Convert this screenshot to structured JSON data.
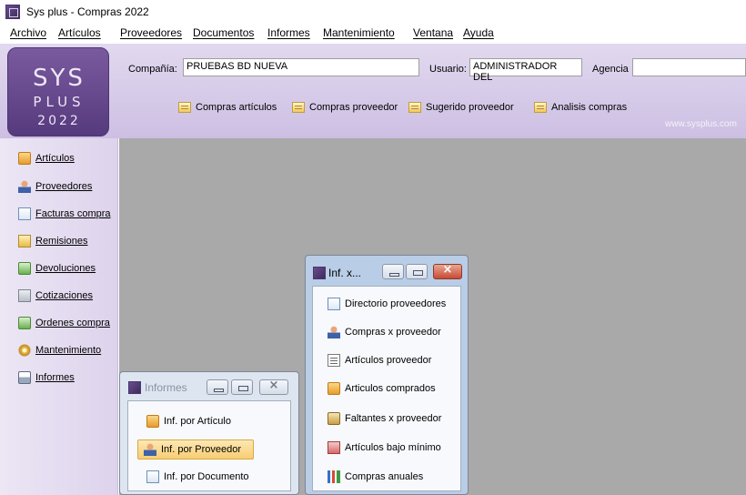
{
  "window": {
    "title": "Sys plus - Compras 2022"
  },
  "menu": [
    {
      "label": "Archivo"
    },
    {
      "label": "Artículos"
    },
    {
      "label": "Proveedores"
    },
    {
      "label": "Documentos"
    },
    {
      "label": "Informes"
    },
    {
      "label": "Mantenimiento"
    },
    {
      "label": "Ventana"
    },
    {
      "label": "Ayuda"
    }
  ],
  "logo": {
    "line1": "SYS",
    "line2": "PLUS",
    "line3": "2022"
  },
  "header": {
    "company_label": "Compañía:",
    "company_value": "PRUEBAS BD NUEVA",
    "user_label": "Usuario:",
    "user_value": "ADMINISTRADOR DEL",
    "agency_label": "Agencia",
    "agency_value": "",
    "website": "www.sysplus.com"
  },
  "toolbar": [
    {
      "label": "Compras artículos",
      "icon": "list-icon"
    },
    {
      "label": "Compras proveedor",
      "icon": "list-icon"
    },
    {
      "label": "Sugerido proveedor",
      "icon": "list-icon"
    },
    {
      "label": "Analisis compras",
      "icon": "list-icon"
    }
  ],
  "sidebar": [
    {
      "label": "Artículos",
      "icon": "box-icon"
    },
    {
      "label": "Proveedores",
      "icon": "person-icon"
    },
    {
      "label": "Facturas compra",
      "icon": "invoice-icon"
    },
    {
      "label": "Remisiones",
      "icon": "folder-icon"
    },
    {
      "label": "Devoluciones",
      "icon": "return-icon"
    },
    {
      "label": "Cotizaciones",
      "icon": "quote-icon"
    },
    {
      "label": "Ordenes compra",
      "icon": "order-icon"
    },
    {
      "label": "Mantenimiento",
      "icon": "gear-icon"
    },
    {
      "label": "Informes",
      "icon": "printer-icon"
    }
  ],
  "informes_window": {
    "title": "Informes",
    "items": [
      {
        "label": "Inf. por Artículo",
        "icon": "box-icon"
      },
      {
        "label": "Inf. por Proveedor",
        "icon": "person-icon",
        "selected": true
      },
      {
        "label": "Inf. por Documento",
        "icon": "document-icon"
      }
    ]
  },
  "inf_x_window": {
    "title": "Inf. x...",
    "items": [
      {
        "label": "Directorio proveedores",
        "icon": "document-icon"
      },
      {
        "label": "Compras x proveedor",
        "icon": "person-icon"
      },
      {
        "label": "Artículos proveedor",
        "icon": "list-icon"
      },
      {
        "label": "Articulos comprados",
        "icon": "box-icon"
      },
      {
        "label": "Faltantes x proveedor",
        "icon": "clipboard-icon"
      },
      {
        "label": "Artículos bajo mínimo",
        "icon": "book-icon"
      },
      {
        "label": "Compras anuales",
        "icon": "bar-chart-icon"
      }
    ]
  }
}
